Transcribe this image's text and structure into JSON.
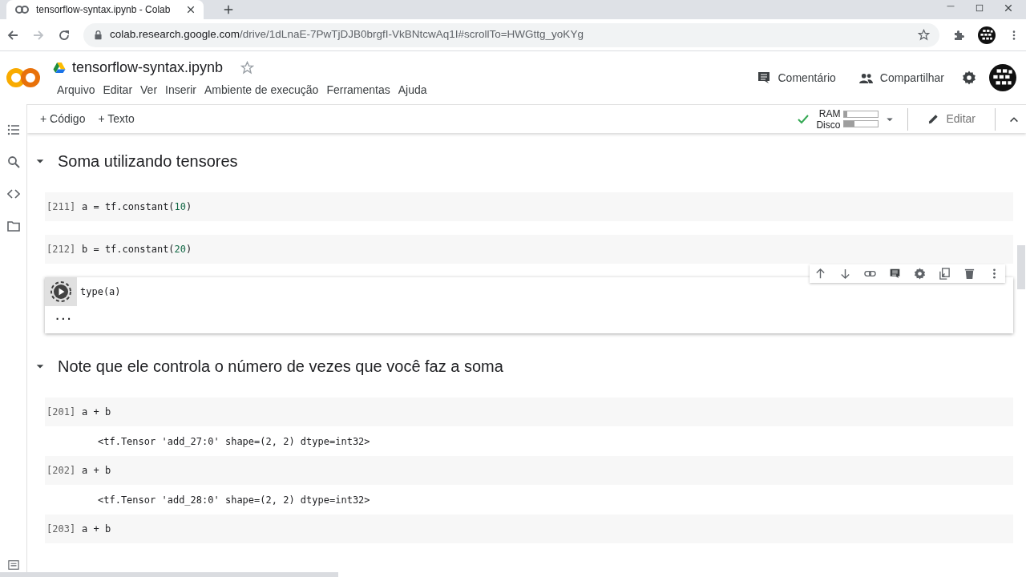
{
  "browser": {
    "tab": {
      "title": "tensorflow-syntax.ipynb - Colab"
    },
    "url": {
      "host": "colab.research.google.com",
      "path": "/drive/1dLnaE-7PwTjDJB0brgfI-VkBNtcwAq1I#scrollTo=HWGttg_yoKYg"
    }
  },
  "notebook": {
    "title": "tensorflow-syntax.ipynb",
    "menu": [
      "Arquivo",
      "Editar",
      "Ver",
      "Inserir",
      "Ambiente de execução",
      "Ferramentas",
      "Ajuda"
    ]
  },
  "header_actions": [
    {
      "label": "Comentário",
      "kind": "comment"
    },
    {
      "label": "Compartilhar",
      "kind": "share"
    }
  ],
  "toolbar": {
    "add_buttons": [
      "+ Código",
      "+ Texto"
    ],
    "connected": true,
    "resources": [
      {
        "label": "RAM",
        "level": 0.08
      },
      {
        "label": "Disco",
        "level": 0.3
      }
    ],
    "edit_button": "Editar"
  },
  "sections": [
    {
      "heading": "Soma utilizando tensores",
      "expanded": true,
      "cells": [
        {
          "count": "[211]",
          "selected": false,
          "code": [
            {
              "text": "a = tf.constant("
            },
            {
              "text": "10",
              "kind": "number"
            },
            {
              "text": ")"
            }
          ]
        },
        {
          "count": "[212]",
          "selected": false,
          "code": [
            {
              "text": "b = tf.constant("
            },
            {
              "text": "20",
              "kind": "number"
            },
            {
              "text": ")"
            }
          ]
        },
        {
          "selected": true,
          "running": true,
          "code": [
            {
              "text": "type(a)"
            }
          ],
          "pending": "..."
        }
      ]
    },
    {
      "heading": "Note que ele controla o número de vezes que você faz a soma",
      "expanded": true,
      "cells": [
        {
          "count": "[201]",
          "selected": false,
          "code": [
            {
              "text": "a + b"
            }
          ],
          "output": "<tf.Tensor 'add_27:0' shape=(2, 2) dtype=int32>"
        },
        {
          "count": "[202]",
          "selected": false,
          "code": [
            {
              "text": "a + b"
            }
          ],
          "output": "<tf.Tensor 'add_28:0' shape=(2, 2) dtype=int32>"
        },
        {
          "count": "[203]",
          "selected": false,
          "code": [
            {
              "text": "a + b"
            }
          ]
        }
      ]
    }
  ]
}
